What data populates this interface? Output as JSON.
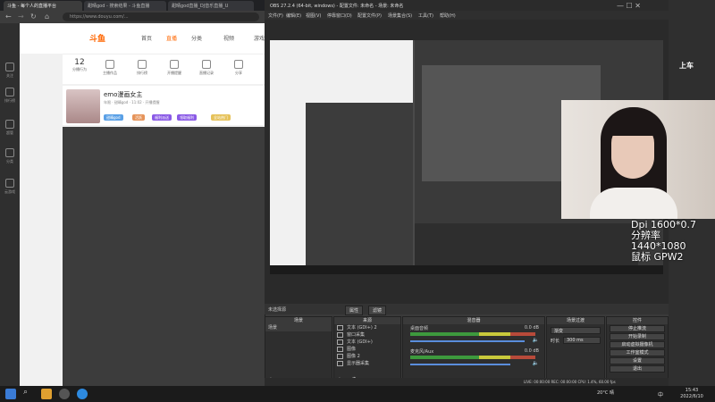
{
  "browser": {
    "tabs": [
      "斗鱼 - 每个人的直播平台",
      "甜晴god - 搜索结果 - 斗鱼直播",
      "甜晴god直播_DJ音乐直播_U"
    ],
    "url": "https://www.douyu.com/..."
  },
  "site": {
    "logo": "斗鱼",
    "nav": [
      "首页",
      "直播",
      "分类",
      "视频",
      "游戏"
    ],
    "rail": [
      "关注",
      "排行榜",
      "超管",
      "分类",
      "云游戏"
    ],
    "stats": [
      {
        "value": "12",
        "label": "分播行为"
      },
      {
        "value": "",
        "label": "主播作品"
      },
      {
        "value": "",
        "label": "排行榜"
      },
      {
        "value": "",
        "label": "开播提醒"
      },
      {
        "value": "",
        "label": "直播记录"
      },
      {
        "value": "",
        "label": "分享"
      }
    ],
    "room_title": "emo漫画女主",
    "room_meta": "年限 · 甜晴god · 11:02 · 开播提醒",
    "badges": [
      "甜晴god",
      "活跃",
      "福利派送",
      "领取福利",
      "全站热门"
    ]
  },
  "obs": {
    "title": "OBS 27.2.4 (64-bit, windows) - 配置文件: 未命名 - 场景: 未命名",
    "menu": [
      "文件(F)",
      "编辑(E)",
      "视图(V)",
      "停靠窗口(D)",
      "配置文件(P)",
      "场景集合(S)",
      "工具(T)",
      "帮助(H)"
    ],
    "preview_strip": [
      "属性",
      "滤镜"
    ],
    "no_source": "未选择源",
    "docks": {
      "scenes": {
        "title": "场景",
        "items": [
          "场景"
        ]
      },
      "sources": {
        "title": "来源",
        "items": [
          "文本 (GDI+) 2",
          "窗口采集",
          "文本 (GDI+)",
          "图像",
          "图像 2",
          "显示器采集"
        ]
      },
      "mixer": {
        "title": "混音器",
        "channels": [
          {
            "name": "桌面音频",
            "db": "0.0 dB"
          },
          {
            "name": "麦克风/Aux",
            "db": "0.0 dB"
          }
        ]
      },
      "transitions": {
        "title": "场景过渡",
        "type": "渐变",
        "duration_label": "时长",
        "duration": "300 ms"
      },
      "controls": {
        "title": "控件",
        "buttons": [
          "停止推流",
          "开始录制",
          "启动虚拟摄像机",
          "工作室模式",
          "设置",
          "退出"
        ]
      }
    },
    "status": "LIVE: 00:00:00  REC: 00:00:00  CPU: 1.4%, 60.00 fps"
  },
  "webcam": {
    "overlay": [
      "Dpi 1600*0.7",
      "分辨率1440*1080",
      "鼠标 GPW2"
    ]
  },
  "right_logo": "上车",
  "taskbar": {
    "weather": "20°C 晴",
    "time": "15:43",
    "date": "2022/6/10",
    "lang": "中"
  }
}
